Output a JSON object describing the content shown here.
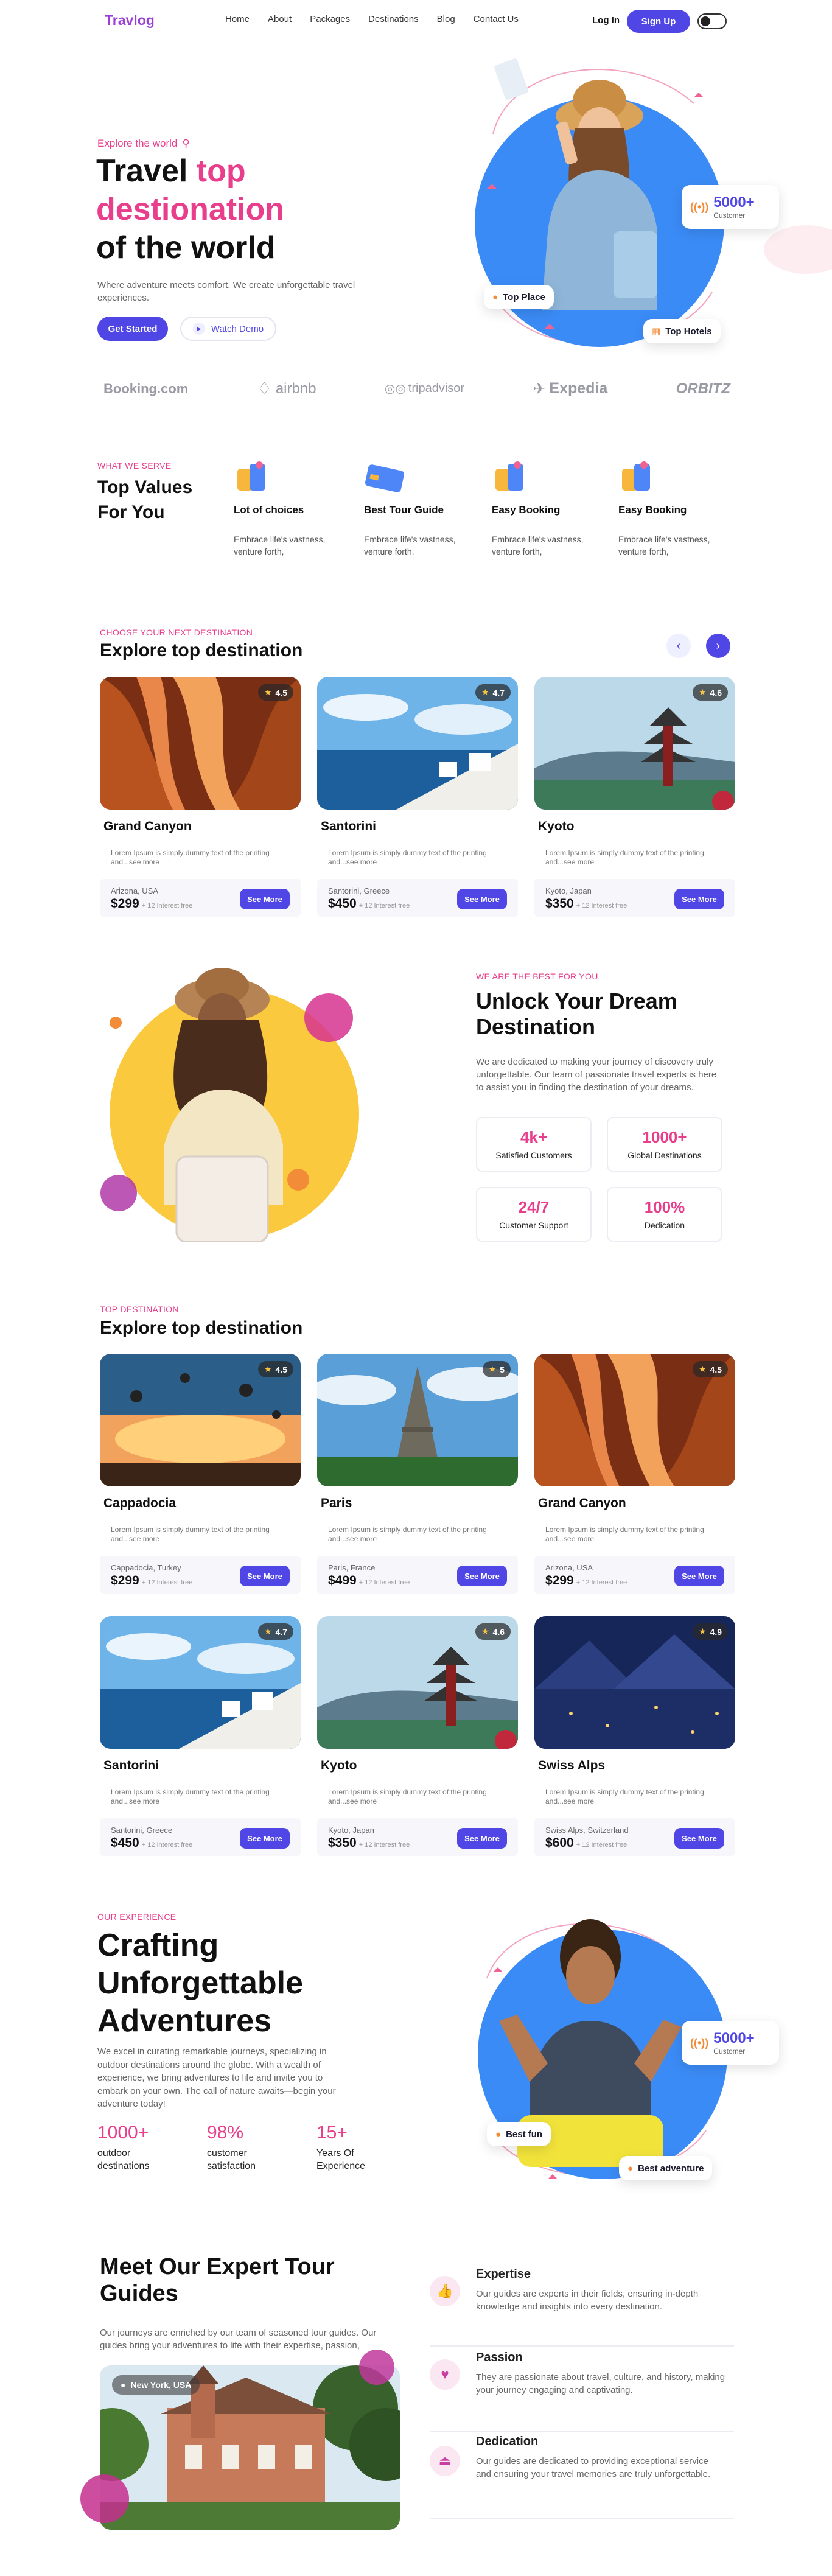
{
  "brand": "Travlog",
  "nav": {
    "items": [
      "Home",
      "About",
      "Packages",
      "Destinations",
      "Blog",
      "Contact Us"
    ],
    "login": "Log In",
    "signup": "Sign Up"
  },
  "hero": {
    "kicker": "Explore the world",
    "title1": "Travel ",
    "title_accent1": "top",
    "title_accent2": "destionation",
    "title3": "of the world",
    "desc": "Where adventure meets comfort. We create unforgettable travel experiences.",
    "cta": "Get Started",
    "watch": "Watch Demo",
    "badge_num": "5000+",
    "badge_label": "Customer",
    "top_place": "Top Place",
    "top_hotels": "Top Hotels"
  },
  "partners": [
    "Booking.com",
    "airbnb",
    "tripadvisor",
    "Expedia",
    "ORBITZ"
  ],
  "values": {
    "kicker": "WHAT WE SERVE",
    "title": "Top Values For You",
    "items": [
      {
        "title": "Lot of choices",
        "desc": "Embrace life's vastness, venture forth,",
        "icon": "luggage-icon"
      },
      {
        "title": "Best Tour Guide",
        "desc": "Embrace life's vastness, venture forth,",
        "icon": "card-icon"
      },
      {
        "title": "Easy Booking",
        "desc": "Embrace life's vastness, venture forth,",
        "icon": "luggage-icon"
      },
      {
        "title": "Easy Booking",
        "desc": "Embrace life's vastness, venture forth,",
        "icon": "luggage-icon"
      }
    ]
  },
  "explore1": {
    "kicker": "CHOOSE YOUR NEXT DESTINATION",
    "title": "Explore top destination",
    "cards": [
      {
        "name": "Grand Canyon",
        "rating": "4.5",
        "desc": "Lorem Ipsum is simply dummy text of the printing and...see more",
        "loc": "Arizona, USA",
        "price": "$299",
        "interest": "+ 12 Interest free",
        "see": "See More",
        "scene": "canyon"
      },
      {
        "name": "Santorini",
        "rating": "4.7",
        "desc": "Lorem Ipsum is simply dummy text of the printing and...see more",
        "loc": "Santorini, Greece",
        "price": "$450",
        "interest": "+ 12 Interest free",
        "see": "See More",
        "scene": "santorini"
      },
      {
        "name": "Kyoto",
        "rating": "4.6",
        "desc": "Lorem Ipsum is simply dummy text of the printing and...see more",
        "loc": "Kyoto, Japan",
        "price": "$350",
        "interest": "+ 12 Interest free",
        "see": "See More",
        "scene": "kyoto"
      }
    ]
  },
  "dream": {
    "kicker": "WE ARE THE BEST FOR YOU",
    "title": "Unlock Your Dream Destination",
    "desc": "We are dedicated to making your journey of discovery truly unforgettable. Our team of passionate travel experts is here to assist you in finding the destination of your dreams.",
    "stats": [
      {
        "n": "4k+",
        "l": "Satisfied Customers"
      },
      {
        "n": "1000+",
        "l": "Global Destinations"
      },
      {
        "n": "24/7",
        "l": "Customer Support"
      },
      {
        "n": "100%",
        "l": "Dedication"
      }
    ]
  },
  "explore2": {
    "kicker": "TOP DESTINATION",
    "title": "Explore top destination",
    "cards": [
      {
        "name": "Cappadocia",
        "rating": "4.5",
        "desc": "Lorem Ipsum is simply dummy text of the printing and...see more",
        "loc": "Cappadocia, Turkey",
        "price": "$299",
        "interest": "+ 12 Interest free",
        "see": "See More",
        "scene": "cappadocia"
      },
      {
        "name": "Paris",
        "rating": "5",
        "desc": "Lorem Ipsum is simply dummy text of the printing and...see more",
        "loc": "Paris, France",
        "price": "$499",
        "interest": "+ 12 Interest free",
        "see": "See More",
        "scene": "paris"
      },
      {
        "name": "Grand Canyon",
        "rating": "4.5",
        "desc": "Lorem Ipsum is simply dummy text of the printing and...see more",
        "loc": "Arizona, USA",
        "price": "$299",
        "interest": "+ 12 Interest free",
        "see": "See More",
        "scene": "canyon"
      },
      {
        "name": "Santorini",
        "rating": "4.7",
        "desc": "Lorem Ipsum is simply dummy text of the printing and...see more",
        "loc": "Santorini, Greece",
        "price": "$450",
        "interest": "+ 12 Interest free",
        "see": "See More",
        "scene": "santorini"
      },
      {
        "name": "Kyoto",
        "rating": "4.6",
        "desc": "Lorem Ipsum is simply dummy text of the printing and...see more",
        "loc": "Kyoto, Japan",
        "price": "$350",
        "interest": "+ 12 Interest free",
        "see": "See More",
        "scene": "kyoto"
      },
      {
        "name": "Swiss Alps",
        "rating": "4.9",
        "desc": "Lorem Ipsum is simply dummy text of the printing and...see more",
        "loc": "Swiss Alps, Switzerland",
        "price": "$600",
        "interest": "+ 12 Interest free",
        "see": "See More",
        "scene": "alps"
      }
    ]
  },
  "experience": {
    "kicker": "OUR EXPERIENCE",
    "title": "Crafting Unforgettable Adventures",
    "desc": "We excel in curating remarkable journeys, specializing in outdoor destinations around the globe. With a wealth of experience, we bring adventures to life and invite you to embark on your own. The call of nature awaits—begin your adventure today!",
    "stats": [
      {
        "n": "1000+",
        "l": "outdoor destinations"
      },
      {
        "n": "98%",
        "l": "customer satisfaction"
      },
      {
        "n": "15+",
        "l": "Years Of Experience"
      }
    ],
    "badge_num": "5000+",
    "badge_label": "Customer",
    "chip1": "Best fun",
    "chip2": "Best adventure"
  },
  "guides": {
    "title": "Meet Our Expert Tour Guides",
    "desc": "Our journeys are enriched by our team of seasoned tour guides. Our guides bring your adventures to life with their expertise, passion,",
    "location": "New York, USA",
    "features": [
      {
        "title": "Expertise",
        "desc": "Our guides are experts in their fields, ensuring in-depth knowledge and insights into every destination.",
        "icon": "thumbs-up-icon"
      },
      {
        "title": "Passion",
        "desc": "They are passionate about travel, culture, and history, making your journey engaging and captivating.",
        "icon": "heart-icon"
      },
      {
        "title": "Dedication",
        "desc": "Our guides are dedicated to providing exceptional service and ensuring your travel memories are truly unforgettable.",
        "icon": "eject-icon"
      }
    ]
  },
  "colors": {
    "primary": "#4f46e5",
    "accent": "#e83e8c",
    "hero_circle": "#3b82f6",
    "dream_circle": "#fbc93d"
  }
}
